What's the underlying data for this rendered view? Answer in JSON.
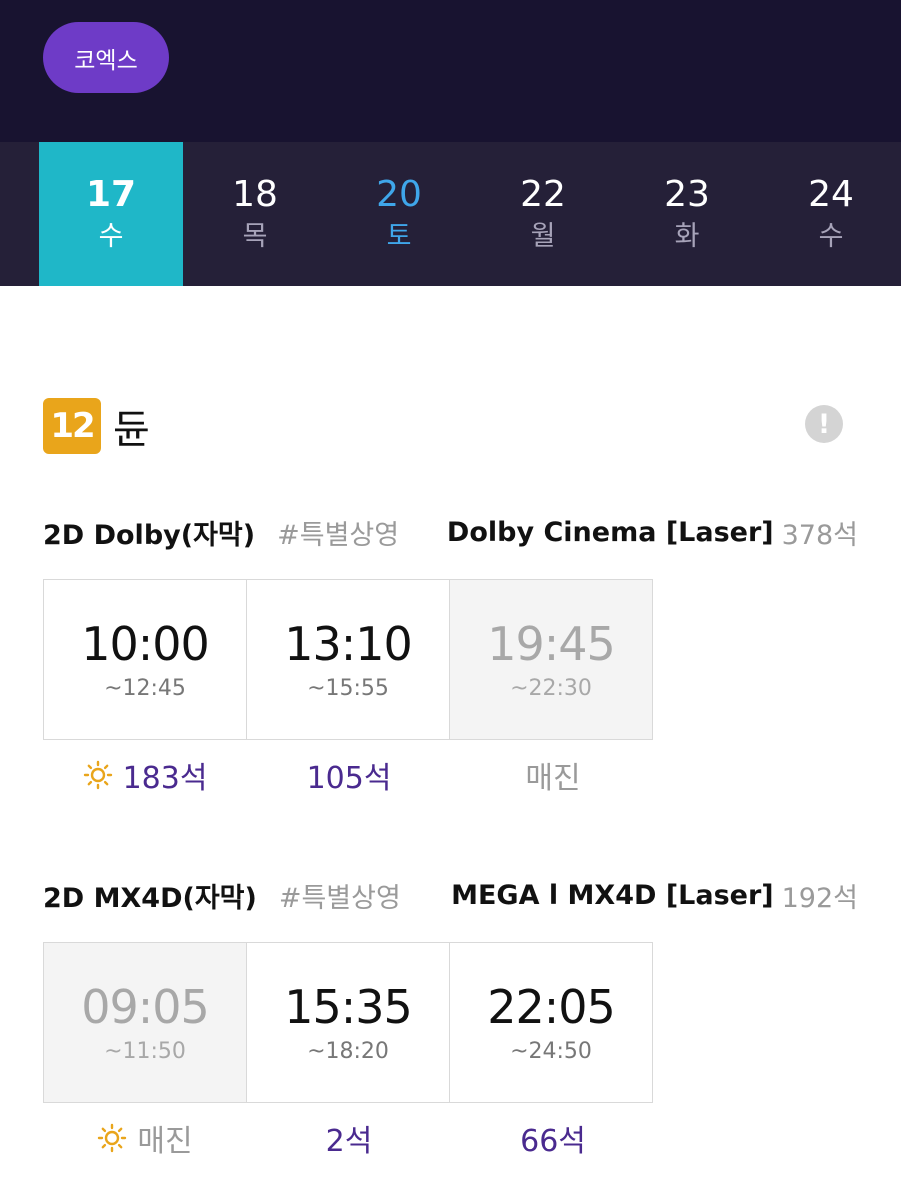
{
  "header": {
    "theater": "코엑스"
  },
  "dates": [
    {
      "num": "17",
      "dow": "수",
      "selected": true
    },
    {
      "num": "18",
      "dow": "목"
    },
    {
      "num": "20",
      "dow": "토",
      "saturday": true
    },
    {
      "num": "22",
      "dow": "월"
    },
    {
      "num": "23",
      "dow": "화"
    },
    {
      "num": "24",
      "dow": "수"
    }
  ],
  "movie": {
    "rating": "12",
    "title": "듄",
    "info_icon": "!"
  },
  "formats": [
    {
      "name": "2D Dolby(자막)",
      "tag": "#특별상영",
      "screen": "Dolby Cinema [Laser]",
      "total_seats": "378석",
      "slots": [
        {
          "start": "10:00",
          "end": "~12:45",
          "seats": "183석",
          "morning": true
        },
        {
          "start": "13:10",
          "end": "~15:55",
          "seats": "105석"
        },
        {
          "start": "19:45",
          "end": "~22:30",
          "seats": "매진",
          "soldout": true
        }
      ]
    },
    {
      "name": "2D MX4D(자막)",
      "tag": "#특별상영",
      "screen": "MEGA l MX4D [Laser]",
      "total_seats": "192석",
      "slots": [
        {
          "start": "09:05",
          "end": "~11:50",
          "seats": "매진",
          "soldout": true,
          "morning": true
        },
        {
          "start": "15:35",
          "end": "~18:20",
          "seats": "2석"
        },
        {
          "start": "22:05",
          "end": "~24:50",
          "seats": "66석"
        }
      ]
    }
  ],
  "colors": {
    "header_bg": "#181330",
    "datebar_bg": "#252038",
    "selected_date": "#1fb7c8",
    "saturday": "#3fa6ea",
    "accent_purple": "#6e3bc7",
    "seats_text": "#4a2a8f",
    "rating_bg": "#e9a51b"
  }
}
